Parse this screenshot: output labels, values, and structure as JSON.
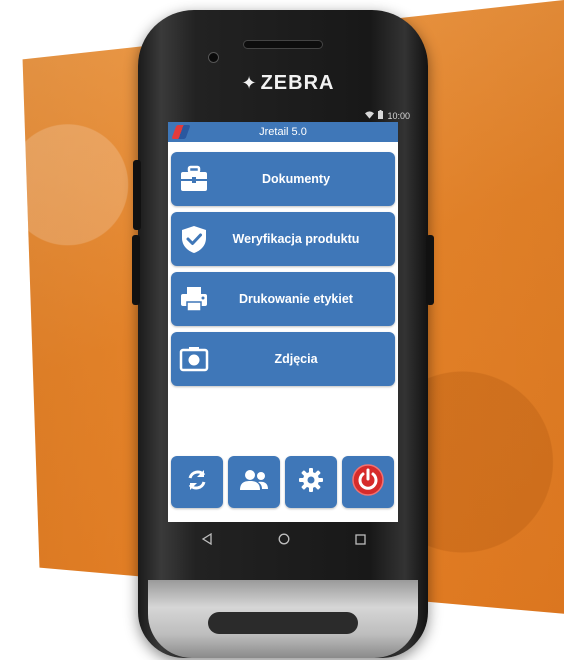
{
  "device": {
    "brand": "ZEBRA",
    "status_time": "10:00"
  },
  "app": {
    "title": "Jretail 5.0"
  },
  "menu": {
    "items": [
      {
        "label": "Dokumenty",
        "icon": "briefcase-icon"
      },
      {
        "label": "Weryfikacja produktu",
        "icon": "shield-check-icon"
      },
      {
        "label": "Drukowanie etykiet",
        "icon": "printer-icon"
      },
      {
        "label": "Zdjęcia",
        "icon": "camera-icon"
      }
    ]
  },
  "toolbar": {
    "buttons": [
      {
        "icon": "sync-icon"
      },
      {
        "icon": "users-icon"
      },
      {
        "icon": "gear-icon"
      },
      {
        "icon": "power-icon"
      }
    ]
  },
  "colors": {
    "accent": "#3f77b8",
    "background": "#e8862b",
    "power": "#d62b2b"
  }
}
